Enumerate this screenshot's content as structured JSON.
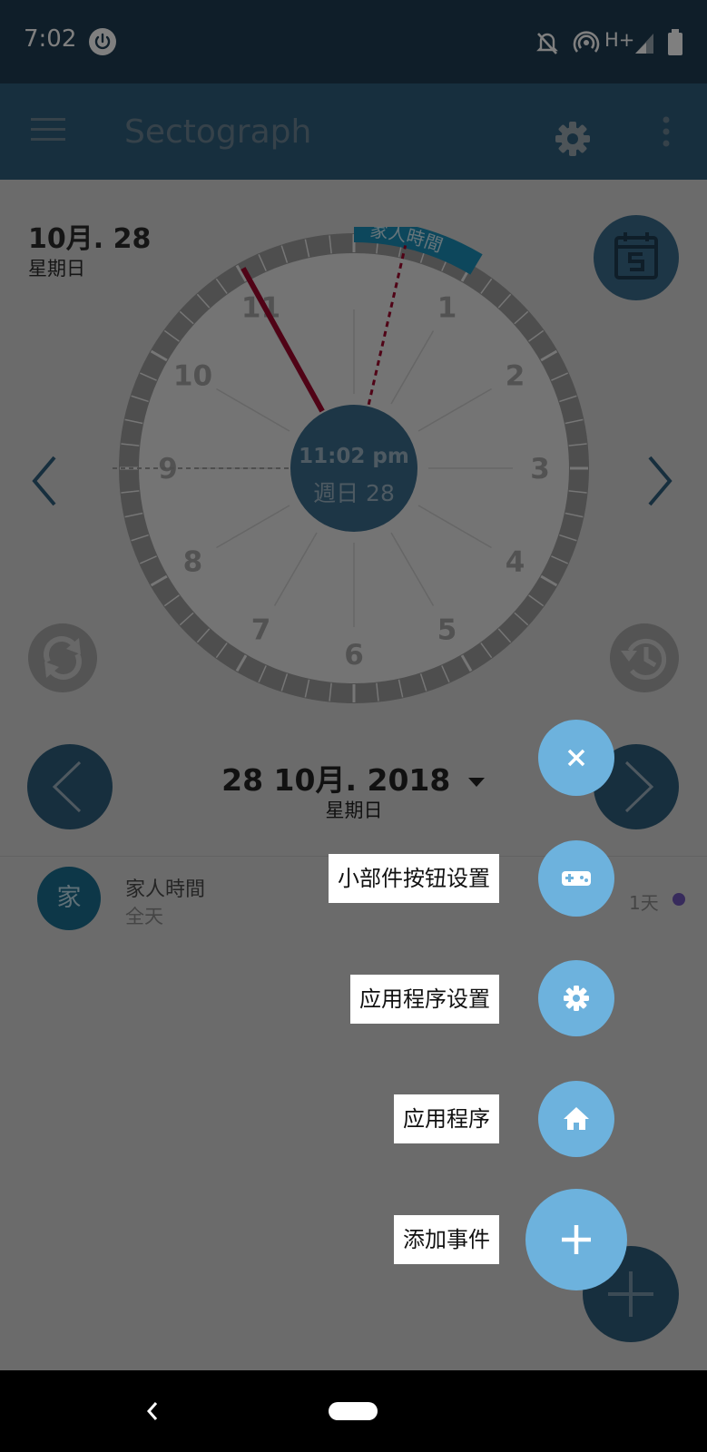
{
  "status_bar": {
    "time": "7:02",
    "network_label": "H+",
    "icons": [
      "power-icon",
      "bell-off-icon",
      "hotspot-icon",
      "signal-icon",
      "battery-icon"
    ]
  },
  "app_bar": {
    "title": "Sectograph",
    "icons": [
      "menu-icon",
      "gear-icon",
      "more-vert-icon"
    ]
  },
  "header": {
    "date": "10月. 28",
    "weekday": "星期日"
  },
  "clock": {
    "center_time": "11:02 pm",
    "center_date": "週日 28",
    "event_arc_label": "家人時間",
    "numbers": [
      "1",
      "2",
      "3",
      "4",
      "5",
      "6",
      "7",
      "8",
      "9",
      "10",
      "11"
    ]
  },
  "date_selector": {
    "date": "28 10月. 2018",
    "weekday": "星期日"
  },
  "event": {
    "avatar_letter": "家",
    "title": "家人時間",
    "subtitle": "全天",
    "duration": "1天"
  },
  "speed_dial": {
    "widget_settings": "小部件按钮设置",
    "app_settings": "应用程序设置",
    "app": "应用程序",
    "add_event": "添加事件"
  },
  "colors": {
    "status_bar": "#1e3d52",
    "app_bar": "#2f5e7d",
    "fab": "#6db2dd",
    "event_hand": "#a0072c",
    "event_arc": "#1a8fb8",
    "event_dot": "#6f56b8"
  }
}
